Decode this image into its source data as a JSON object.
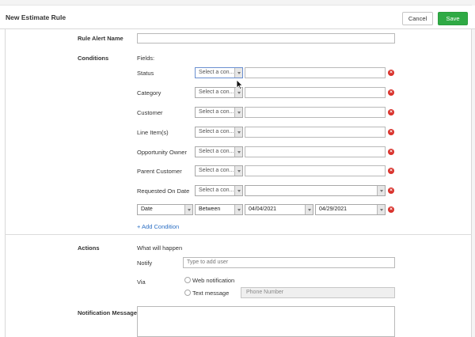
{
  "header": {
    "title": "New Estimate Rule",
    "cancel_label": "Cancel",
    "save_label": "Save",
    "save_color": "#2faa45"
  },
  "form": {
    "rule_alert_name": {
      "label": "Rule Alert Name",
      "value": ""
    },
    "conditions": {
      "label": "Conditions",
      "fields_label": "Fields:",
      "rows": [
        {
          "field": "Status",
          "operator_placeholder": "Select a con...",
          "value": ""
        },
        {
          "field": "Category",
          "operator_placeholder": "Select a con...",
          "value": ""
        },
        {
          "field": "Customer",
          "operator_placeholder": "Select a con...",
          "value": ""
        },
        {
          "field": "Line Item(s)",
          "operator_placeholder": "Select a con...",
          "value": ""
        },
        {
          "field": "Opportunity Owner",
          "operator_placeholder": "Select a con...",
          "value": ""
        },
        {
          "field": "Parent Customer",
          "operator_placeholder": "Select a con...",
          "value": ""
        },
        {
          "field": "Requested On Date",
          "operator_placeholder": "Select a con...",
          "value": ""
        }
      ],
      "date_row": {
        "field": "Date",
        "operator": "Between",
        "from": "04/04/2021",
        "to": "04/29/2021"
      },
      "add_condition_label": "+ Add Condition",
      "remove_icon_color": "#d9322c"
    },
    "actions": {
      "label": "Actions",
      "what_will_happen": "What will happen",
      "notify_label": "Notify",
      "notify_placeholder": "Type to add user",
      "via_label": "Via",
      "web_notification_label": "Web notification",
      "text_message_label": "Text message",
      "phone_placeholder": "Phone Number"
    },
    "notification_message": {
      "label": "Notification Message",
      "value": ""
    }
  }
}
